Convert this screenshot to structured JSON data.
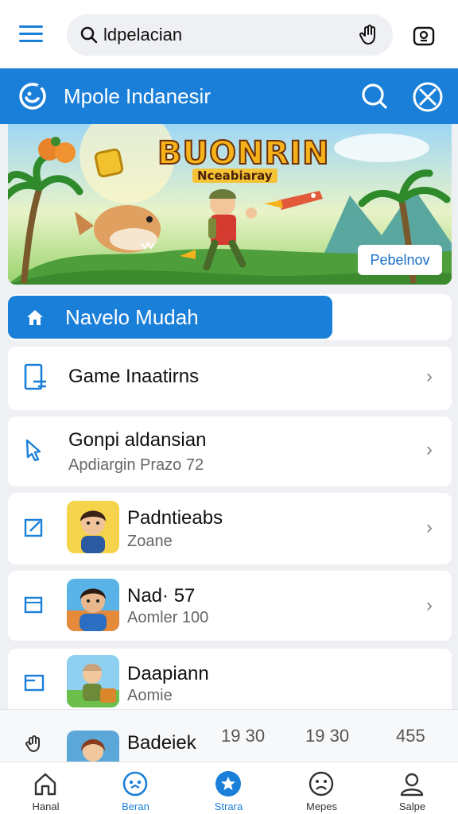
{
  "topbar": {
    "search_value": "ldpelacian"
  },
  "header": {
    "title": "Mpole Indanesir"
  },
  "banner": {
    "title": "BUONRIN",
    "subtitle": "Nceabiaray",
    "button_label": "Pebelnov"
  },
  "nav": {
    "label": "Navelo Mudah"
  },
  "list": [
    {
      "title": "Game Inaatirns",
      "subtitle": ""
    },
    {
      "title": "Gonpi aldansian",
      "subtitle": "Apdiargin Prazo 72"
    },
    {
      "title": "Padntieabs",
      "subtitle": "Zoane"
    },
    {
      "title": "Nad· 57",
      "subtitle": "Aomler 100"
    },
    {
      "title": "Daapiann",
      "subtitle": "Aomie"
    },
    {
      "title": "Badeiek",
      "subtitle": ""
    }
  ],
  "stats": [
    "19 30",
    "19 30",
    "455"
  ],
  "bottom_nav": [
    {
      "label": "Hanal",
      "icon": "home-icon"
    },
    {
      "label": "Beran",
      "icon": "face-icon"
    },
    {
      "label": "Strara",
      "icon": "star-icon"
    },
    {
      "label": "Mepes",
      "icon": "sad-face-icon"
    },
    {
      "label": "Salpe",
      "icon": "person-icon"
    }
  ],
  "colors": {
    "accent": "#1a7fd8",
    "background": "#eef0f3"
  }
}
